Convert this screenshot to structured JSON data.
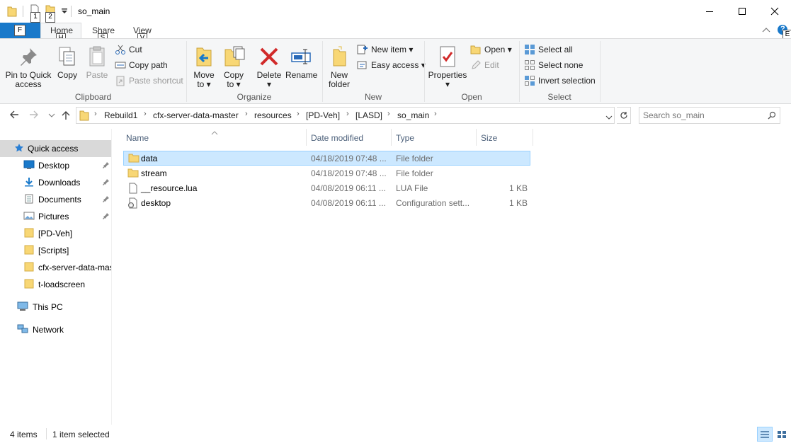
{
  "window": {
    "title": "so_main",
    "quick_access_badges": [
      "1",
      "2"
    ],
    "minimize_glyph": "—",
    "maximize_glyph": "☐",
    "close_glyph": "✕"
  },
  "ribbon_tabs": {
    "file": "F",
    "home": "Home",
    "home_key": "H",
    "share": "Share",
    "share_key": "S",
    "view": "View",
    "view_key": "V",
    "help_key": "E",
    "help_glyph": "?"
  },
  "clipboard": {
    "pin_label_1": "Pin to Quick",
    "pin_label_2": "access",
    "copy": "Copy",
    "paste": "Paste",
    "cut": "Cut",
    "copy_path": "Copy path",
    "paste_shortcut": "Paste shortcut",
    "group": "Clipboard"
  },
  "organize": {
    "move_1": "Move",
    "move_2": "to",
    "copy_1": "Copy",
    "copy_2": "to",
    "delete": "Delete",
    "rename": "Rename",
    "group": "Organize"
  },
  "new": {
    "new_folder_1": "New",
    "new_folder_2": "folder",
    "new_item": "New item",
    "easy_access": "Easy access",
    "group": "New"
  },
  "open": {
    "properties": "Properties",
    "open": "Open",
    "edit": "Edit",
    "group": "Open"
  },
  "select": {
    "select_all": "Select all",
    "select_none": "Select none",
    "invert": "Invert selection",
    "group": "Select"
  },
  "address": {
    "crumbs": [
      "Rebuild1",
      "cfx-server-data-master",
      "resources",
      "[PD-Veh]",
      "[LASD]",
      "so_main"
    ]
  },
  "search": {
    "placeholder": "Search so_main"
  },
  "nav": {
    "quick_access": "Quick access",
    "desktop": "Desktop",
    "downloads": "Downloads",
    "documents": "Documents",
    "pictures": "Pictures",
    "pd_veh": "[PD-Veh]",
    "scripts": "[Scripts]",
    "cfx": "cfx-server-data-mas",
    "loadscreen": "t-loadscreen",
    "this_pc": "This PC",
    "network": "Network"
  },
  "columns": {
    "name": "Name",
    "date": "Date modified",
    "type": "Type",
    "size": "Size"
  },
  "files": [
    {
      "name": "data",
      "date": "04/18/2019 07:48 ...",
      "type": "File folder",
      "size": ""
    },
    {
      "name": "stream",
      "date": "04/18/2019 07:48 ...",
      "type": "File folder",
      "size": ""
    },
    {
      "name": "__resource.lua",
      "date": "04/08/2019 06:11 ...",
      "type": "LUA File",
      "size": "1 KB"
    },
    {
      "name": "desktop",
      "date": "04/08/2019 06:11 ...",
      "type": "Configuration sett...",
      "size": "1 KB"
    }
  ],
  "status": {
    "count": "4 items",
    "selected": "1 item selected"
  },
  "colors": {
    "accent": "#1979ca",
    "selection": "#cce8ff",
    "folder": "#f8d775"
  }
}
